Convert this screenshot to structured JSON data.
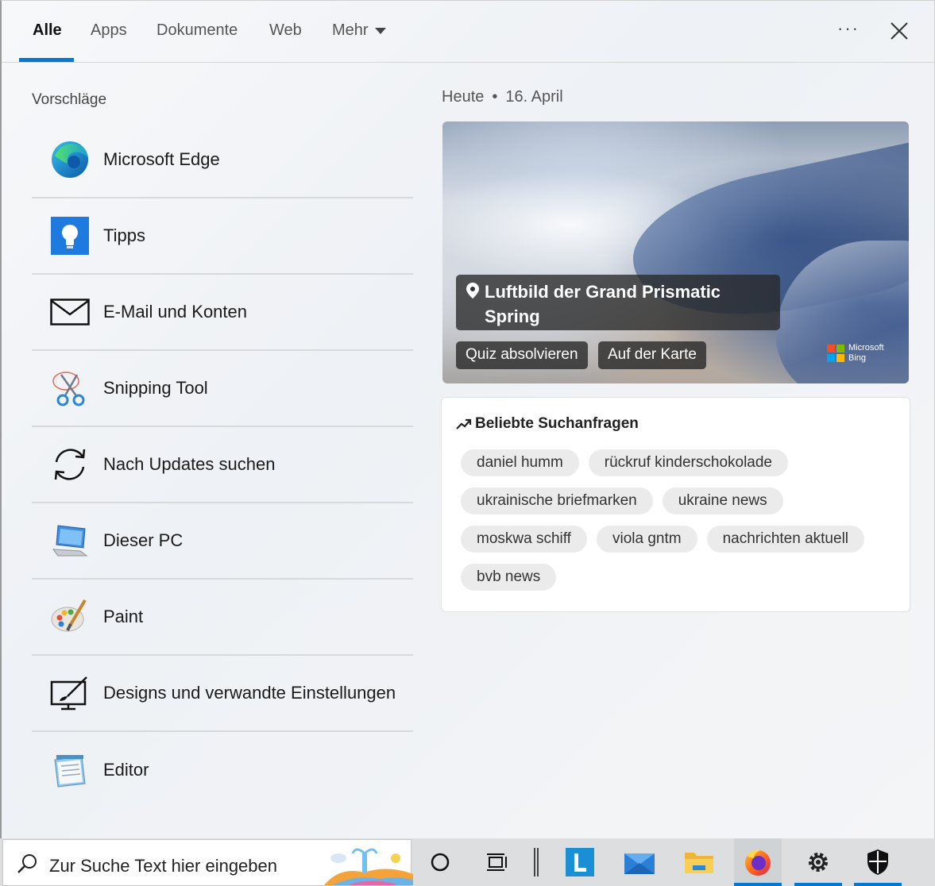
{
  "tabs": [
    {
      "label": "Alle"
    },
    {
      "label": "Apps"
    },
    {
      "label": "Dokumente"
    },
    {
      "label": "Web"
    },
    {
      "label": "Mehr"
    }
  ],
  "header": {
    "more_icon": "ellipsis-icon",
    "close_icon": "close-icon"
  },
  "suggestions": {
    "title": "Vorschläge",
    "items": [
      {
        "label": "Microsoft Edge",
        "icon": "edge-icon"
      },
      {
        "label": "Tipps",
        "icon": "tips-icon"
      },
      {
        "label": "E-Mail und Konten",
        "icon": "mail-icon"
      },
      {
        "label": "Snipping Tool",
        "icon": "scissors-icon"
      },
      {
        "label": "Nach Updates suchen",
        "icon": "sync-icon"
      },
      {
        "label": "Dieser PC",
        "icon": "computer-icon"
      },
      {
        "label": "Paint",
        "icon": "paint-icon"
      },
      {
        "label": "Designs und verwandte Einstellungen",
        "icon": "design-icon"
      },
      {
        "label": "Editor",
        "icon": "notepad-icon"
      }
    ]
  },
  "today": {
    "label": "Heute",
    "separator": "•",
    "date": "16. April"
  },
  "hero": {
    "title": "Luftbild der Grand Prismatic Spring",
    "quiz_button": "Quiz absolvieren",
    "map_button": "Auf der Karte",
    "brand_line1": "Microsoft",
    "brand_line2": "Bing"
  },
  "trending": {
    "title": "Beliebte Suchanfragen",
    "chips": [
      "daniel humm",
      "rückruf kinderschokolade",
      "ukrainische briefmarken",
      "ukraine news",
      "moskwa schiff",
      "viola gntm",
      "nachrichten aktuell",
      "bvb news"
    ]
  },
  "taskbar": {
    "search_placeholder": "Zur Suche Text hier eingeben",
    "icons": [
      "cortana-icon",
      "task-view-icon",
      "divider",
      "launcher-icon",
      "mail-icon",
      "file-explorer-icon",
      "firefox-icon",
      "settings-icon",
      "security-icon"
    ]
  },
  "colors": {
    "accent": "#0078d4",
    "chip_bg": "#ebebeb"
  }
}
